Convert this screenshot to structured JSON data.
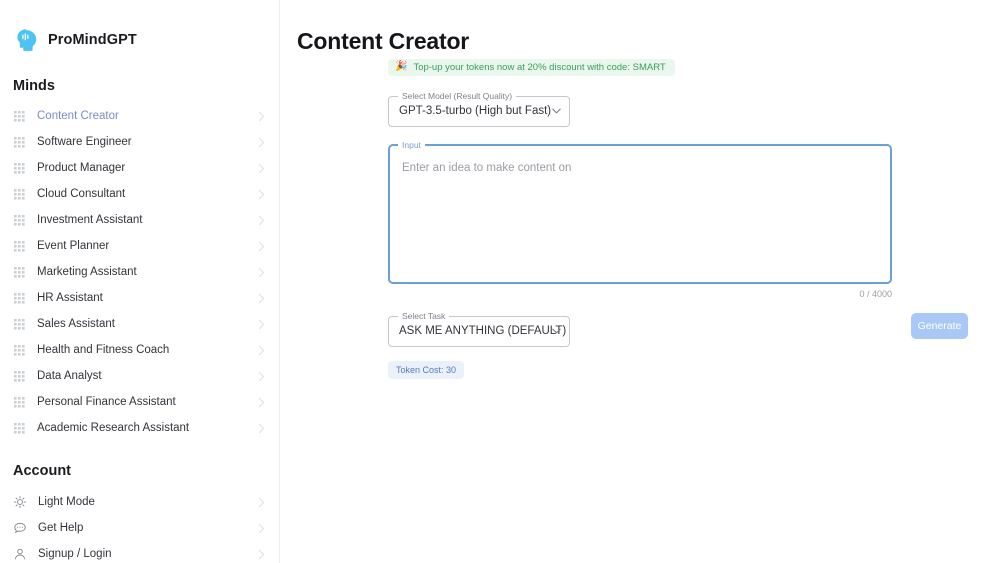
{
  "brand": {
    "name": "ProMindGPT",
    "logo_icon": "mind-head-icon",
    "logo_color": "#4cc3f0"
  },
  "sidebar": {
    "minds_heading": "Minds",
    "account_heading": "Account",
    "handle_icon": "drag-handle-grid-icon",
    "chevron_icon": "chevron-right-icon",
    "active_color": "#7b8cc4",
    "minds": [
      {
        "label": "Content Creator",
        "active": true
      },
      {
        "label": "Software Engineer",
        "active": false
      },
      {
        "label": "Product Manager",
        "active": false
      },
      {
        "label": "Cloud Consultant",
        "active": false
      },
      {
        "label": "Investment Assistant",
        "active": false
      },
      {
        "label": "Event Planner",
        "active": false
      },
      {
        "label": "Marketing Assistant",
        "active": false
      },
      {
        "label": "HR Assistant",
        "active": false
      },
      {
        "label": "Sales Assistant",
        "active": false
      },
      {
        "label": "Health and Fitness Coach",
        "active": false
      },
      {
        "label": "Data Analyst",
        "active": false
      },
      {
        "label": "Personal Finance Assistant",
        "active": false
      },
      {
        "label": "Academic Research Assistant",
        "active": false
      }
    ],
    "account": [
      {
        "label": "Light Mode",
        "icon": "sun-icon"
      },
      {
        "label": "Get Help",
        "icon": "chat-bubble-icon"
      },
      {
        "label": "Signup / Login",
        "icon": "person-icon"
      }
    ]
  },
  "main": {
    "page_title": "Content Creator",
    "promo": {
      "emoji": "🎉",
      "emoji_name": "party-popper-icon",
      "text": "Top-up your tokens now at 20% discount with code: SMART",
      "bg_color": "#e9f7ec",
      "text_color": "#3a9e5c"
    },
    "model_select": {
      "label": "Select Model (Result Quality)",
      "value": "GPT-3.5-turbo (High but Fast)"
    },
    "input_field": {
      "label": "Input",
      "placeholder": "Enter an idea to make content on",
      "value": "",
      "counter": "0 / 4000",
      "focus_color": "#6a9fd8"
    },
    "task_select": {
      "label": "Select Task",
      "value": "ASK ME ANYTHING (DEFAULT)"
    },
    "token_cost": "Token Cost: 30",
    "generate_button": {
      "label": "Generate",
      "color": "#a9c8f5"
    }
  }
}
